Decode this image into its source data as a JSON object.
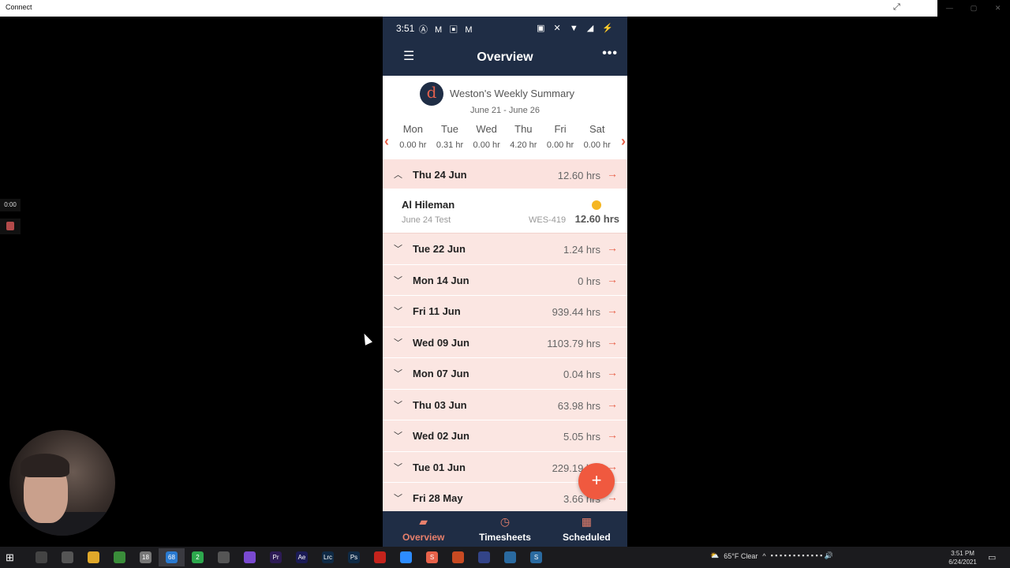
{
  "window": {
    "title": "Connect"
  },
  "recorder": {
    "timer": "0:00"
  },
  "phone": {
    "status": {
      "time": "3:51",
      "left_icons": "Ⓐ M ▣ M",
      "right_icons": "▣ ✕ ▼ ◢ ⚡"
    },
    "appbar": {
      "title": "Overview"
    },
    "summary": {
      "heading": "Weston's Weekly Summary",
      "range": "June 21 - June 26",
      "days": [
        {
          "name": "Mon",
          "hours": "0.00 hr"
        },
        {
          "name": "Tue",
          "hours": "0.31 hr"
        },
        {
          "name": "Wed",
          "hours": "0.00 hr"
        },
        {
          "name": "Thu",
          "hours": "4.20 hr"
        },
        {
          "name": "Fri",
          "hours": "0.00 hr"
        },
        {
          "name": "Sat",
          "hours": "0.00 hr"
        }
      ]
    },
    "expanded": {
      "date": "Thu 24 Jun",
      "hours": "12.60 hrs",
      "entry": {
        "name": "Al Hileman",
        "note": "June 24 Test",
        "code": "WES-419",
        "hours": "12.60 hrs"
      }
    },
    "rows": [
      {
        "date": "Tue 22 Jun",
        "hours": "1.24 hrs"
      },
      {
        "date": "Mon 14 Jun",
        "hours": "0 hrs"
      },
      {
        "date": "Fri 11 Jun",
        "hours": "939.44 hrs"
      },
      {
        "date": "Wed 09 Jun",
        "hours": "1103.79 hrs"
      },
      {
        "date": "Mon 07 Jun",
        "hours": "0.04 hrs"
      },
      {
        "date": "Thu 03 Jun",
        "hours": "63.98 hrs"
      },
      {
        "date": "Wed 02 Jun",
        "hours": "5.05 hrs"
      },
      {
        "date": "Tue 01 Jun",
        "hours": "229.19 hrs"
      },
      {
        "date": "Fri 28 May",
        "hours": "3.66 hrs"
      }
    ],
    "fab": "+",
    "nav": [
      {
        "label": "Overview",
        "icon": "▰"
      },
      {
        "label": "Timesheets",
        "icon": "◷"
      },
      {
        "label": "Scheduled",
        "icon": "▦"
      }
    ]
  },
  "taskbar": {
    "weather": "65°F  Clear",
    "time": "3:51 PM",
    "date": "6/24/2021",
    "icons": [
      {
        "name": "task-view",
        "color": "#444",
        "label": ""
      },
      {
        "name": "explorer",
        "color": "#555",
        "label": ""
      },
      {
        "name": "files",
        "color": "#e0a82a",
        "label": ""
      },
      {
        "name": "chrome",
        "color": "#3a8d3a",
        "label": ""
      },
      {
        "name": "app-18",
        "color": "#777",
        "label": "18"
      },
      {
        "name": "app-68",
        "color": "#2a7ad0",
        "label": "68"
      },
      {
        "name": "app-2",
        "color": "#2da84d",
        "label": "2"
      },
      {
        "name": "slack",
        "color": "#555",
        "label": ""
      },
      {
        "name": "app-a",
        "color": "#7a4ad0",
        "label": ""
      },
      {
        "name": "premiere",
        "color": "#2d1b55",
        "label": "Pr"
      },
      {
        "name": "after-effects",
        "color": "#1b1b55",
        "label": "Ae"
      },
      {
        "name": "lightroom",
        "color": "#0f2a45",
        "label": "Lrc"
      },
      {
        "name": "photoshop",
        "color": "#0f2a45",
        "label": "Ps"
      },
      {
        "name": "acrobat",
        "color": "#c4231c",
        "label": ""
      },
      {
        "name": "zoom",
        "color": "#2d8cff",
        "label": ""
      },
      {
        "name": "app-s",
        "color": "#e8624a",
        "label": "S"
      },
      {
        "name": "powerpoint",
        "color": "#c84a22",
        "label": ""
      },
      {
        "name": "app-b",
        "color": "#334488",
        "label": ""
      },
      {
        "name": "app-c",
        "color": "#2a6aa0",
        "label": ""
      },
      {
        "name": "app-d",
        "color": "#2a6aa0",
        "label": "S"
      }
    ]
  }
}
